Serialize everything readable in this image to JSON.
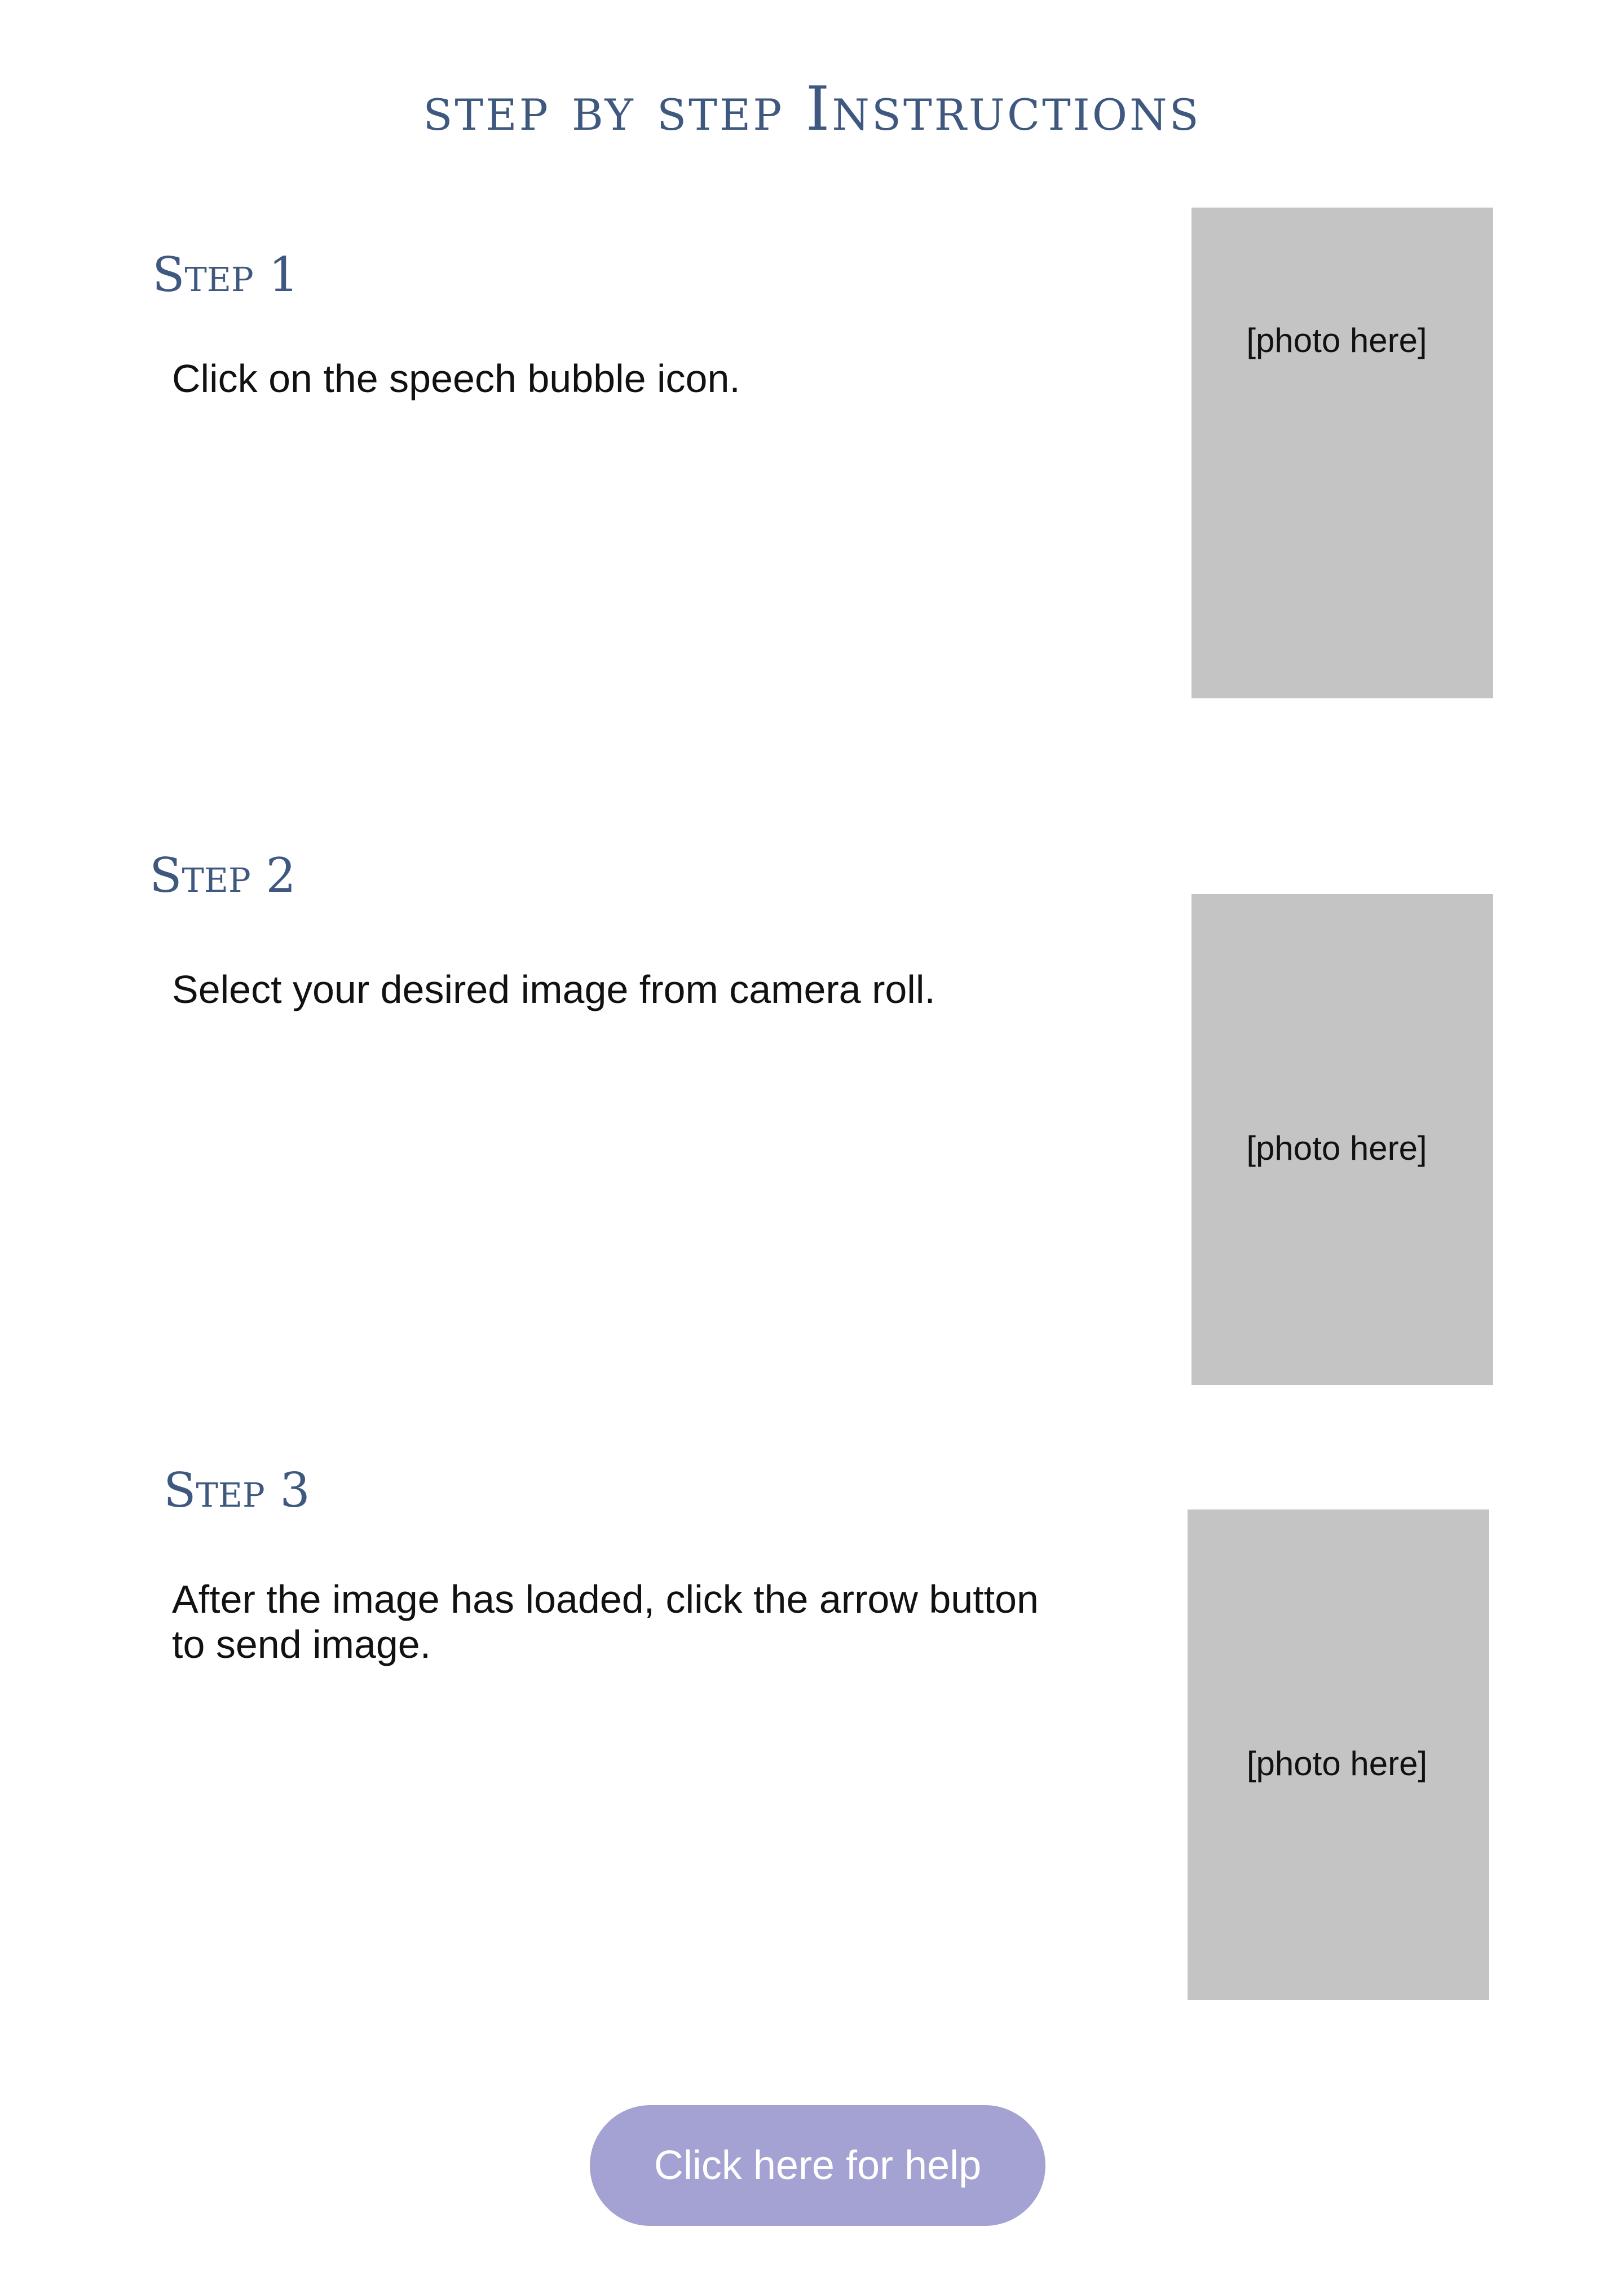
{
  "title": "step by step Instructions",
  "steps": [
    {
      "heading": "Step 1",
      "text": "Click on the speech bubble icon.",
      "photo_label": "[photo here]"
    },
    {
      "heading": "Step 2",
      "text": "Select your desired image from camera roll.",
      "photo_label": "[photo here]"
    },
    {
      "heading": "Step 3",
      "text": "After the image has loaded, click the arrow button to send image.",
      "photo_label": "[photo here]"
    }
  ],
  "help_button": {
    "label": "Click here for help"
  },
  "colors": {
    "heading": "#3f5880",
    "photo_placeholder": "#c4c4c4",
    "button": "#a3a2d2",
    "button_text": "#ffffff"
  }
}
